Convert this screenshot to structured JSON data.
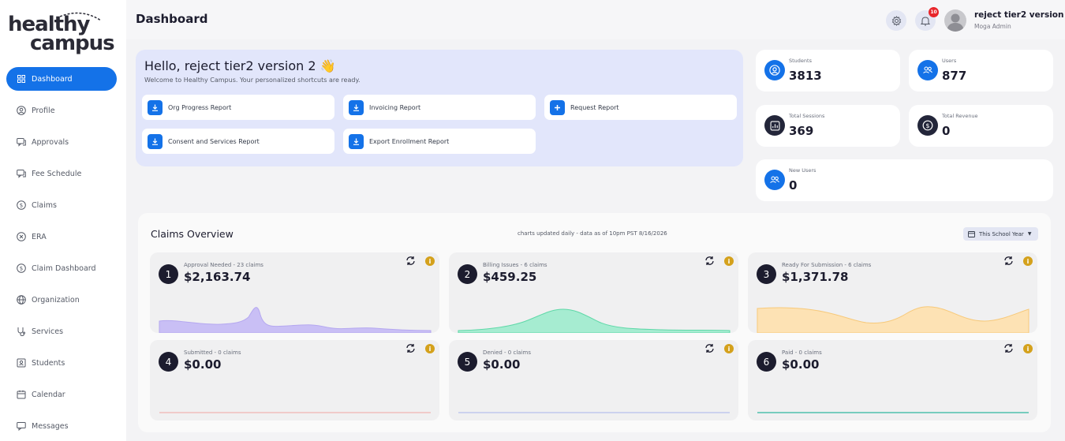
{
  "logo": {
    "line1": "healthy",
    "line2": "campus"
  },
  "sidebar": {
    "items": [
      {
        "label": "Dashboard",
        "icon": "grid-icon",
        "active": true
      },
      {
        "label": "Profile",
        "icon": "user-circle-icon"
      },
      {
        "label": "Approvals",
        "icon": "chat-check-icon"
      },
      {
        "label": "Fee Schedule",
        "icon": "chat-check-icon"
      },
      {
        "label": "Claims",
        "icon": "dollar-circle-icon"
      },
      {
        "label": "ERA",
        "icon": "badge-icon"
      },
      {
        "label": "Claim Dashboard",
        "icon": "dollar-circle-icon"
      },
      {
        "label": "Organization",
        "icon": "globe-icon"
      },
      {
        "label": "Services",
        "icon": "stethoscope-icon"
      },
      {
        "label": "Students",
        "icon": "id-card-icon"
      },
      {
        "label": "Calendar",
        "icon": "calendar-icon"
      },
      {
        "label": "Messages",
        "icon": "message-icon"
      }
    ]
  },
  "header": {
    "title": "Dashboard",
    "notification_count": "10",
    "user_name": "reject tier2 version 2",
    "user_role": "Moga Admin"
  },
  "welcome": {
    "greeting": "Hello, reject tier2 version 2 👋",
    "subtitle": "Welcome to Healthy Campus. Your personalized shortcuts are ready.",
    "shortcuts": [
      {
        "label": "Org Progress Report",
        "icon": "download-icon"
      },
      {
        "label": "Invoicing Report",
        "icon": "download-icon"
      },
      {
        "label": "Request Report",
        "icon": "plus-icon"
      },
      {
        "label": "Consent and Services Report",
        "icon": "download-icon"
      },
      {
        "label": "Export Enrollment Report",
        "icon": "download-icon"
      }
    ]
  },
  "stats": [
    {
      "label": "Students",
      "value": "3813",
      "icon": "user-circle-icon",
      "color": "#1472e8"
    },
    {
      "label": "Users",
      "value": "877",
      "icon": "users-icon",
      "color": "#1472e8"
    },
    {
      "label": "Total Sessions",
      "value": "369",
      "icon": "chart-icon",
      "color": "#23263a"
    },
    {
      "label": "Total Revenue",
      "value": "0",
      "icon": "dollar-circle-icon",
      "color": "#23263a"
    },
    {
      "label": "New Users",
      "value": "0",
      "icon": "users-icon",
      "color": "#1472e8"
    }
  ],
  "claims_overview": {
    "title": "Claims Overview",
    "note": "charts updated daily - data as of 10pm PST 8/16/2026",
    "period_select": "This School Year",
    "cards": [
      {
        "number": "1",
        "label": "Approval Needed - 23 claims",
        "amount": "$2,163.74",
        "color": "#c9bff5",
        "stroke": "#b5a8f0"
      },
      {
        "number": "2",
        "label": "Billing Issues - 6 claims",
        "amount": "$459.25",
        "color": "#a6ecd1",
        "stroke": "#5fd8a8"
      },
      {
        "number": "3",
        "label": "Ready For Submission - 6 claims",
        "amount": "$1,371.78",
        "color": "#fde2b4",
        "stroke": "#f7c97a"
      },
      {
        "number": "4",
        "label": "Submitted - 0 claims",
        "amount": "$0.00",
        "color": "#f5c4c4",
        "stroke": "#f0a3a3"
      },
      {
        "number": "5",
        "label": "Denied - 0 claims",
        "amount": "$0.00",
        "color": "#c8cff0",
        "stroke": "#a8b3ea"
      },
      {
        "number": "6",
        "label": "Paid - 0 claims",
        "amount": "$0.00",
        "color": "#7bd6c4",
        "stroke": "#2fb7a0"
      }
    ]
  }
}
